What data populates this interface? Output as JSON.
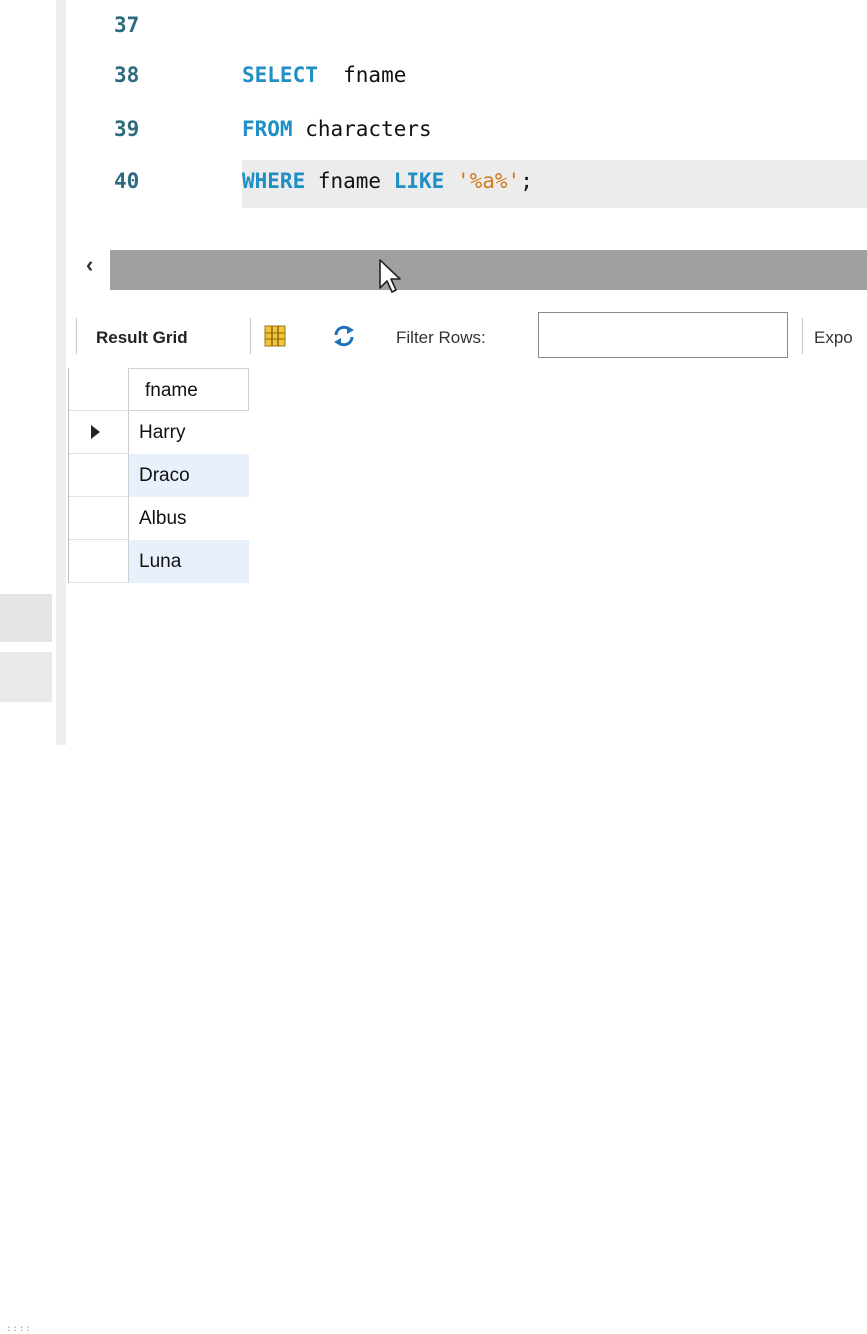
{
  "editor": {
    "lines": [
      {
        "num": "37",
        "tokens": []
      },
      {
        "num": "38",
        "tokens": [
          {
            "t": "kw",
            "v": "SELECT"
          },
          {
            "t": "id",
            "v": "  fname"
          }
        ]
      },
      {
        "num": "39",
        "tokens": [
          {
            "t": "kw",
            "v": "FROM"
          },
          {
            "t": "id",
            "v": " characters"
          }
        ]
      },
      {
        "num": "40",
        "tokens": [
          {
            "t": "kw",
            "v": "WHERE"
          },
          {
            "t": "id",
            "v": " fname "
          },
          {
            "t": "kw",
            "v": "LIKE"
          },
          {
            "t": "id",
            "v": " "
          },
          {
            "t": "str",
            "v": "'%a%'"
          },
          {
            "t": "id",
            "v": ";"
          }
        ]
      }
    ]
  },
  "scrollbar": {
    "left_arrow": "‹"
  },
  "toolbar": {
    "result_grid_label": "Result Grid",
    "grid_icon": "grid-icon",
    "refresh_icon": "refresh-icon",
    "filter_label": "Filter Rows:",
    "filter_value": "",
    "export_label": "Expo"
  },
  "grid": {
    "column": "fname",
    "rows": [
      "Harry",
      "Draco",
      "Albus",
      "Luna"
    ],
    "selected_row": 0
  },
  "colors": {
    "keyword": "#1f8fc5",
    "string": "#cf7a1c",
    "line_number": "#2e6b7e",
    "alt_row": "#e8f0fb",
    "scroll_thumb": "#a0a0a0"
  }
}
